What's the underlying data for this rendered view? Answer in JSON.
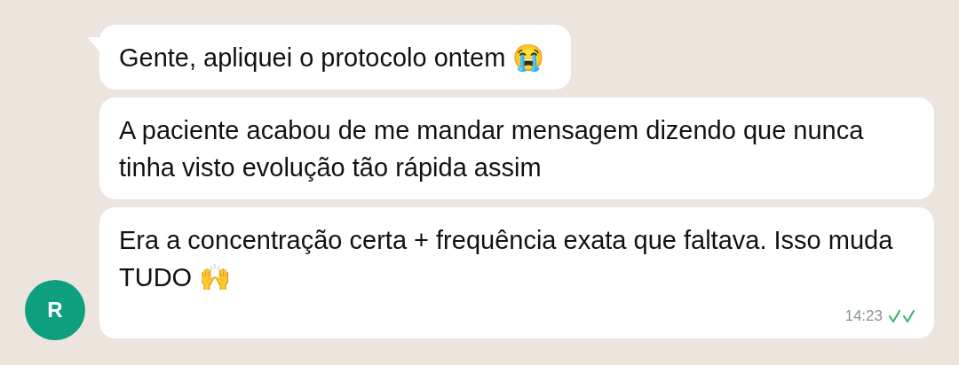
{
  "avatar": {
    "initial": "R",
    "color": "#0e9f7e"
  },
  "messages": [
    {
      "text": "Gente, apliquei o protocolo ontem 😭",
      "tail": true
    },
    {
      "text": "A paciente acabou de me mandar mensagem dizendo que nunca tinha visto evolução tão rápida assim",
      "tail": false
    },
    {
      "text": "Era a concentração certa + frequência exata que faltava. Isso muda TUDO 🙌",
      "tail": false,
      "time": "14:23",
      "read": true
    }
  ]
}
